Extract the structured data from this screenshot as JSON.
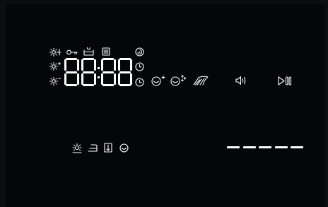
{
  "display": {
    "digits": "88:88",
    "dashes": [
      "-",
      "-",
      "-",
      "-",
      "-"
    ]
  },
  "icons": {
    "row1": [
      "light-temp-icon",
      "key-lock-icon",
      "wash-basin-icon",
      "filter-icon",
      "spin-icon"
    ],
    "row2": [
      "light-temp-plus-icon",
      "timer-icon"
    ],
    "row3": [
      "light-temp-minus-icon",
      "clock-icon",
      "steam-plus-icon",
      "steam-plus2-icon",
      "dry-icon",
      "sound-icon",
      "play-pause-icon"
    ],
    "bottom": [
      "sun-icon",
      "iron-icon",
      "door-icon",
      "rinse-icon"
    ]
  },
  "colors": {
    "segment": "#ffffff",
    "background": "#050607"
  }
}
